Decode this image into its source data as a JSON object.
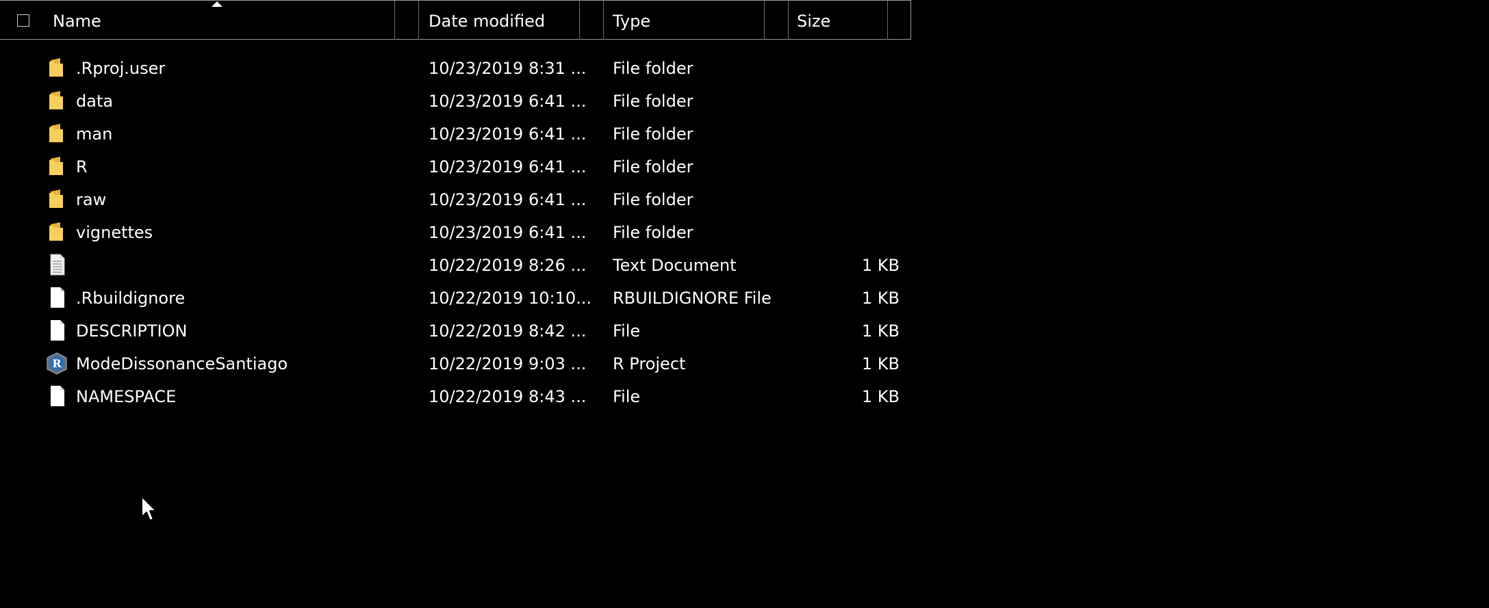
{
  "header": {
    "name": "Name",
    "date_modified": "Date modified",
    "type": "Type",
    "size": "Size"
  },
  "files": [
    {
      "name": ".Rproj.user",
      "date": "10/23/2019 8:31 ...",
      "type": "File folder",
      "size": "",
      "icon": "folder-icon"
    },
    {
      "name": "data",
      "date": "10/23/2019 6:41 ...",
      "type": "File folder",
      "size": "",
      "icon": "folder-icon"
    },
    {
      "name": "man",
      "date": "10/23/2019 6:41 ...",
      "type": "File folder",
      "size": "",
      "icon": "folder-icon"
    },
    {
      "name": "R",
      "date": "10/23/2019 6:41 ...",
      "type": "File folder",
      "size": "",
      "icon": "folder-icon"
    },
    {
      "name": "raw",
      "date": "10/23/2019 6:41 ...",
      "type": "File folder",
      "size": "",
      "icon": "folder-icon"
    },
    {
      "name": "vignettes",
      "date": "10/23/2019 6:41 ...",
      "type": "File folder",
      "size": "",
      "icon": "folder-icon"
    },
    {
      "name": "",
      "date": "10/22/2019 8:26 ...",
      "type": "Text Document",
      "size": "1 KB",
      "icon": "text-document-icon"
    },
    {
      "name": ".Rbuildignore",
      "date": "10/22/2019 10:10...",
      "type": "RBUILDIGNORE File",
      "size": "1 KB",
      "icon": "blank-file-icon"
    },
    {
      "name": "DESCRIPTION",
      "date": "10/22/2019 8:42 ...",
      "type": "File",
      "size": "1 KB",
      "icon": "blank-file-icon"
    },
    {
      "name": "ModeDissonanceSantiago",
      "date": "10/22/2019 9:03 ...",
      "type": "R Project",
      "size": "1 KB",
      "icon": "r-project-icon"
    },
    {
      "name": "NAMESPACE",
      "date": "10/22/2019 8:43 ...",
      "type": "File",
      "size": "1 KB",
      "icon": "blank-file-icon"
    }
  ],
  "colors": {
    "background": "#000000",
    "text": "#ffffff",
    "folder": "#f5c84c",
    "header_border": "#9a9a9a"
  }
}
